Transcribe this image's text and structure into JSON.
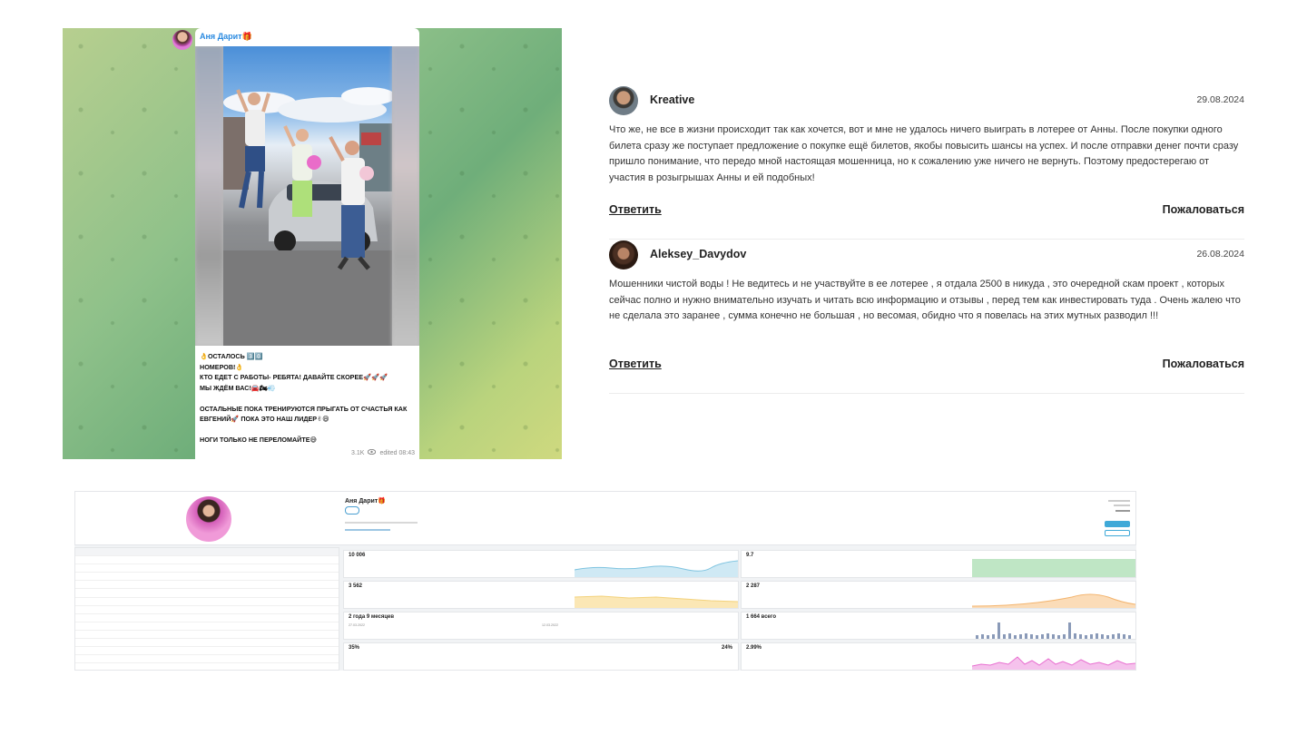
{
  "telegram_post": {
    "channel_name": "Аня Дарит🎁",
    "message_text": "👌ОСТАЛОСЬ 3️⃣0️⃣\nНОМЕРОВ!👌\nКТО ЕДЕТ С РАБОТЫ- РЕБЯТА! ДАВАЙТЕ СКОРЕЕ🚀🚀🚀\nМЫ ЖДЁМ ВАС!🚘🏍💨\n\nОСТАЛЬНЫЕ ПОКА ТРЕНИРУЮТСЯ ПРЫГАТЬ ОТ СЧАСТЬЯ КАК ЕВГЕНИЙ🚀 ПОКА ЭТО НАШ ЛИДЕР✌😄\n\nНОГИ ТОЛЬКО НЕ ПЕРЕЛОМАЙТЕ😅",
    "views": "3.1K",
    "edited_label": "edited 08:43",
    "icons": {
      "views": "eye-icon"
    },
    "colors": {
      "name": "#2a8ae0",
      "background": "#8fc18a"
    }
  },
  "comments": [
    {
      "author": "Kreative",
      "date": "29.08.2024",
      "text": "Что же, не все в жизни происходит так как хочется, вот и мне не удалось ничего выиграть в лотерее от Анны. После покупки одного билета сразу же поступает предложение о покупке ещё билетов, якобы повысить шансы на успех. И после отправки денег почти сразу пришло понимание, что передо мной настоящая мошенница, но к сожалению уже ничего не вернуть. Поэтому предостерегаю от участия в розыгрышах Анны и ей подобных!",
      "reply_label": "Ответить",
      "report_label": "Пожаловаться"
    },
    {
      "author": "Aleksey_Davydov",
      "date": "26.08.2024",
      "text": "Мошенники чистой воды ! Не ведитесь и не участвуйте в ее лотерее , я отдала 2500 в никуда , это очередной скам проект , которых сейчас полно и нужно внимательно изучать и читать всю информацию и отзывы , перед тем как инвестировать туда . Очень жалею что не сделала это заранее , сумма конечно не большая , но весомая, обидно что я повелась на этих мутных разводил !!!",
      "reply_label": "Ответить",
      "report_label": "Пожаловаться"
    }
  ],
  "dashboard": {
    "channel_title": "Аня Дарит🎁",
    "cards": [
      {
        "value": "10 006",
        "color": "#7fc4e0"
      },
      {
        "value": "9.7",
        "color": "#8fd49a"
      },
      {
        "value": "3 562",
        "color": "#f3d27c"
      },
      {
        "value": "2 287",
        "color": "#f3b46e"
      },
      {
        "value": "2 года 9 месяцев",
        "color": "#ffffff"
      },
      {
        "value": "1 664 всего",
        "color": "#8a9ab8"
      },
      {
        "value": "35%",
        "color": "#ffffff"
      },
      {
        "value": "2.99%",
        "color": "#e86fd0"
      }
    ],
    "dates": [
      "27.03.2022",
      "12.03.2022"
    ],
    "right_value": "24%"
  }
}
